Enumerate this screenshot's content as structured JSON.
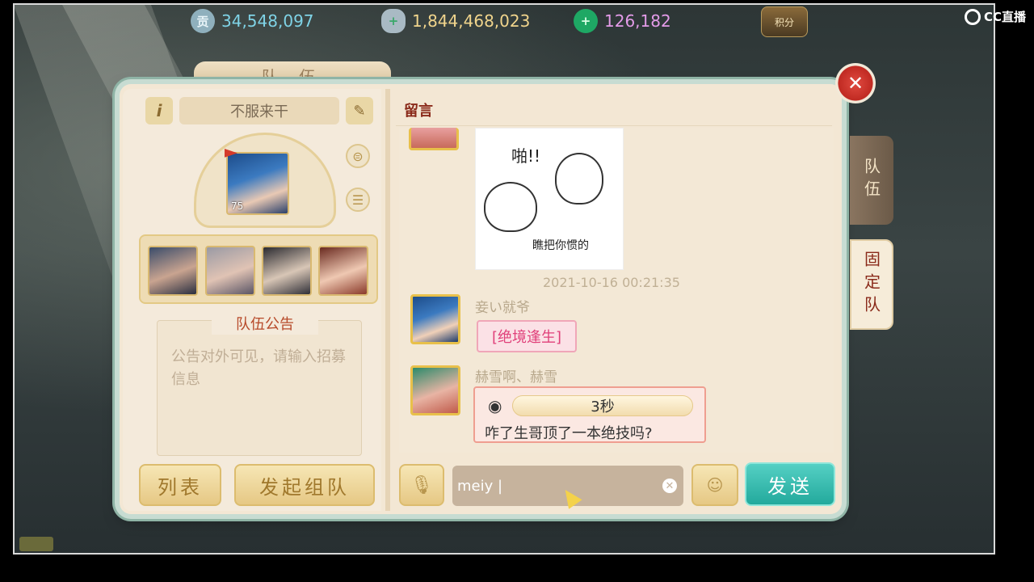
{
  "resources": {
    "currency1": {
      "icon": "gong-coin-icon",
      "glyph": "贡",
      "value": "34,548,097",
      "color": "#7fd3e6"
    },
    "currency2": {
      "icon": "silver-ingot-icon",
      "value": "1,844,468,023",
      "color": "#f0d48c"
    },
    "currency3": {
      "icon": "jade-icon",
      "value": "126,182",
      "color": "#e39be8"
    },
    "points_label": "积分"
  },
  "watermark": "CC直播",
  "panel": {
    "title": "队 伍",
    "team_name": "不服来干",
    "leader_level": "75",
    "notice_title": "队伍公告",
    "notice_placeholder": "公告对外可见，请输入招募信息",
    "list_button": "列表",
    "start_button": "发起组队"
  },
  "chat": {
    "header": "留言",
    "sticker_text_top": "啪!!",
    "sticker_text_bottom": "瞧把你惯的",
    "timestamp": "2021-10-16 00:21:35",
    "messages": [
      {
        "user": "妾い就爷",
        "text": "[绝境逢生]"
      },
      {
        "user": "赫雪啊、赫雪",
        "voice_length": "3秒",
        "text": "咋了生哥顶了一本绝技吗?"
      }
    ],
    "input_value": "meiy |",
    "send_button": "发送"
  },
  "side_tabs": {
    "team": "队伍",
    "fixed": "固定队"
  },
  "colors": {
    "accent_teal": "#23a99c",
    "panel_bg": "#f3e7d4",
    "red": "#c02a22"
  }
}
